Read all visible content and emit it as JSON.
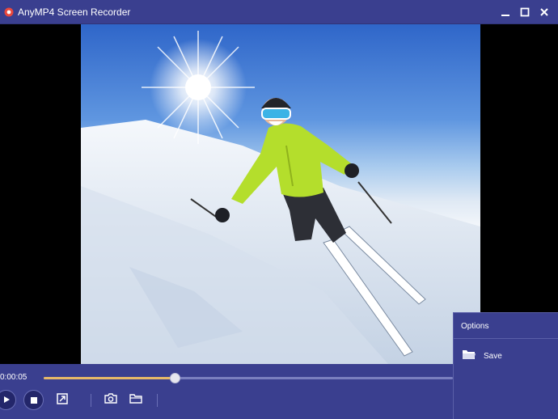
{
  "window": {
    "title": "AnyMP4 Screen Recorder",
    "icons": {
      "app": "app-logo-icon",
      "minimize": "minimize-icon",
      "maximize": "maximize-icon",
      "close": "close-icon"
    }
  },
  "video": {
    "description_icons": [
      "sun-icon",
      "skier-figure"
    ],
    "colors": {
      "sky_top": "#2f66c9",
      "snow": "#f4f7fb",
      "jacket": "#b4de2c"
    }
  },
  "playback": {
    "time": "0:00:05",
    "progress_percent": 32
  },
  "toolbar": {
    "icons": [
      "play-icon",
      "stop-icon",
      "export-icon",
      "camera-icon",
      "folder-icon"
    ]
  },
  "options": {
    "title": "Options",
    "save_label": "Save"
  },
  "theme": {
    "panel": "#3a3f8f",
    "accent": "#e7b968"
  }
}
